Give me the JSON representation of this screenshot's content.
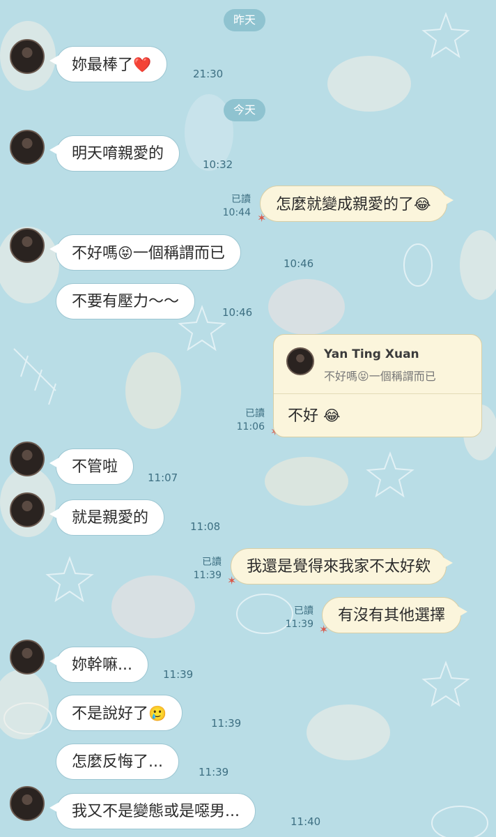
{
  "dates": {
    "yesterday": "昨天",
    "today": "今天"
  },
  "messages": [
    {
      "text": "妳最棒了",
      "emoji": "❤️",
      "time": "21:30"
    },
    {
      "text": "明天唷親愛的",
      "time": "10:32"
    },
    {
      "text": "怎麼就變成親愛的了",
      "emoji": "😂",
      "read": "已讀",
      "time": "10:44"
    },
    {
      "text": "不好嗎",
      "emoji": "😝",
      "text2": "一個稱謂而已",
      "time": "10:46"
    },
    {
      "text": "不要有壓力～～",
      "time": "10:46"
    },
    {
      "text": "不管啦",
      "time": "11:07"
    },
    {
      "text": "就是親愛的",
      "time": "11:08"
    },
    {
      "text": "我還是覺得來我家不太好欸",
      "read": "已讀",
      "time": "11:39"
    },
    {
      "text": "有沒有其他選擇",
      "read": "已讀",
      "time": "11:39"
    },
    {
      "text": "妳幹嘛...",
      "time": "11:39"
    },
    {
      "text": "不是說好了",
      "emoji": "🥲",
      "time": "11:39"
    },
    {
      "text": "怎麼反悔了...",
      "time": "11:39"
    },
    {
      "text": "我又不是變態或是噁男...",
      "time": "11:40"
    }
  ],
  "reply": {
    "name": "Yan Ting Xuan",
    "quote_text": "不好嗎",
    "quote_emoji": "😝",
    "quote_text2": "一個稱謂而已",
    "body": "不好",
    "body_emoji": "😂",
    "read": "已讀",
    "time": "11:06"
  },
  "icons": {
    "read_marker": "starfish-icon",
    "avatar": "user-avatar"
  },
  "colors": {
    "background": "#b9dde6",
    "incoming": "#ffffff",
    "outgoing": "#fbf5dc",
    "date_pill": "#8fc3d0"
  }
}
